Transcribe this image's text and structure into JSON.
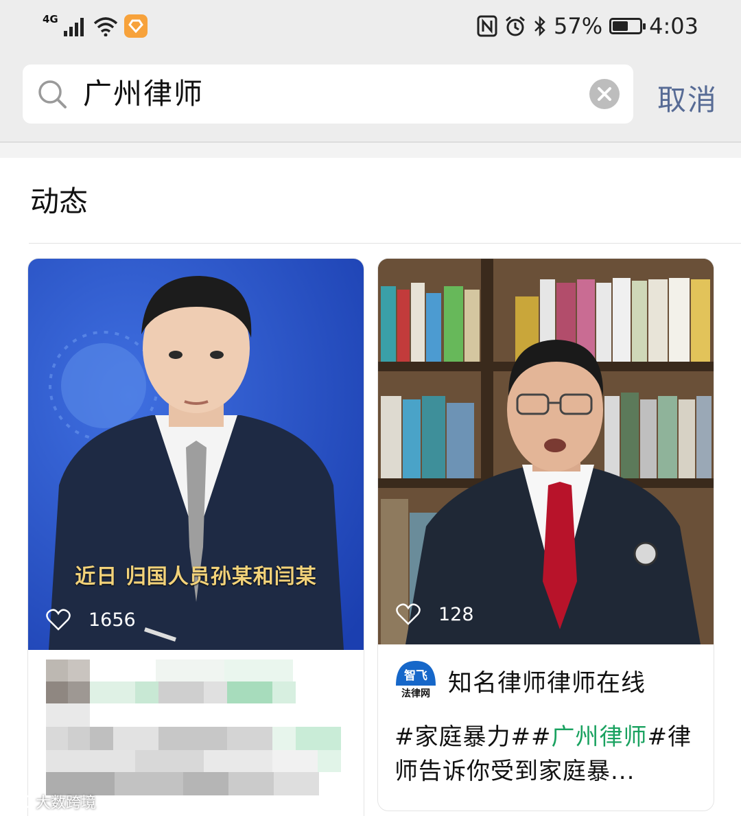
{
  "status_bar": {
    "network": "4G",
    "battery_percent": "57%",
    "battery_level": 0.57,
    "time": "4:03"
  },
  "search": {
    "query": "广州律师",
    "cancel_label": "取消"
  },
  "section": {
    "title": "动态"
  },
  "posts": [
    {
      "caption": "近日 归国人员孙某和闫某",
      "likes": "1656"
    },
    {
      "likes": "128",
      "author_logo_top": "智飞",
      "author_logo_bottom": "法律网",
      "author_name": "知名律师律师在线",
      "text_before": "#家庭暴力##",
      "text_highlight": "广州律师",
      "text_after": "#律师告诉你受到家庭暴..."
    }
  ],
  "watermark": "大数跨境",
  "colors": {
    "link": "#576b95",
    "highlight": "#1aa260",
    "caption": "#f2d27a"
  }
}
